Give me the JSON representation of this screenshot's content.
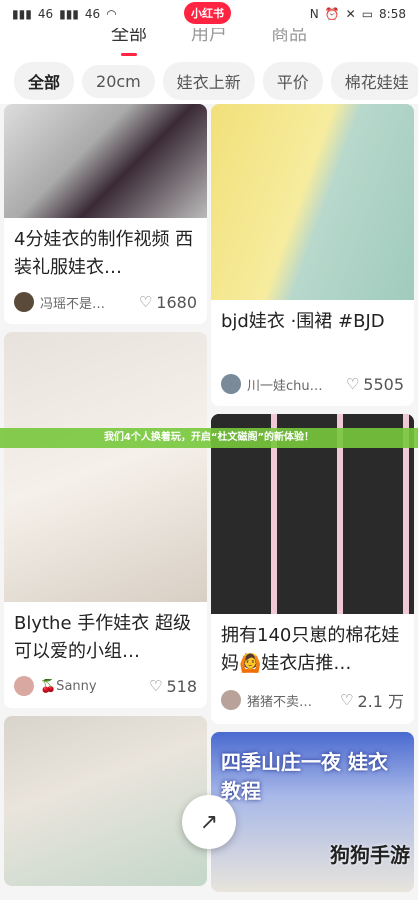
{
  "status": {
    "time": "8:58",
    "carrier_left": "46",
    "carrier_right": "46"
  },
  "app_badge": "小红书",
  "top_tabs": [
    "全部",
    "用户",
    "商品"
  ],
  "chips": [
    "全部",
    "20cm",
    "娃衣上新",
    "平价",
    "棉花娃娃"
  ],
  "cards_left": [
    {
      "title": "4分娃衣的制作视频 西装礼服娃衣…",
      "author": "冯瑶不是…",
      "likes": "1680"
    },
    {
      "title": "Blythe 手作娃衣 超级可以爱的小组…",
      "author": "🍒Sanny",
      "likes": "518"
    }
  ],
  "cards_right": [
    {
      "title": "bjd娃衣 ·围裙 #BJD",
      "author": "川一娃chu…",
      "likes": "5505"
    },
    {
      "title": "拥有140只崽的棉花娃妈🙆娃衣店推…",
      "author": "猪猪不卖…",
      "likes": "2.1 万"
    }
  ],
  "banner_text": "我们4个人换着玩，开启“杜文磁阁”的新体验！",
  "bottom_right_card_text": "四季山庄一夜 娃衣教程",
  "watermark": "狗狗手游",
  "colors": {
    "accent": "#ff2442"
  }
}
